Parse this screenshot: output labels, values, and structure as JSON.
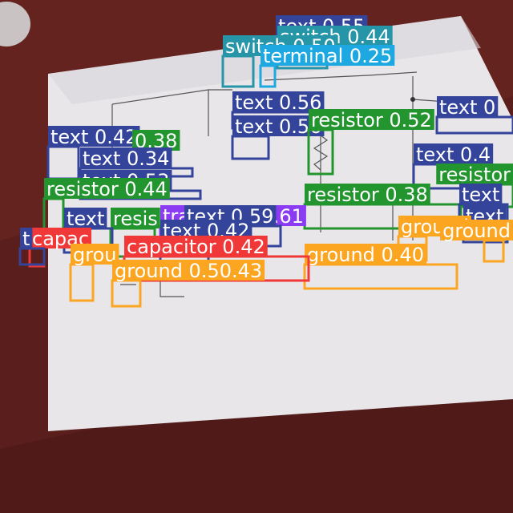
{
  "photo": {
    "subject": "hand-drawn circuit sketch on paper",
    "background_color": "#5a1f1c",
    "paper_color": "#e9e6ea"
  },
  "class_colors": {
    "text": "#33449a",
    "resistor": "#23952f",
    "switch": "#2795a8",
    "terminal": "#1ea8e2",
    "transistor": "#8b3cf2",
    "capacitor": "#ef3837",
    "ground": "#fba521"
  },
  "detections": [
    {
      "cls": "text",
      "label": "text 0.55"
    },
    {
      "cls": "switch",
      "label": "switch 0.44"
    },
    {
      "cls": "switch",
      "label": "switch 0.50"
    },
    {
      "cls": "terminal",
      "label": "terminal 0.25"
    },
    {
      "cls": "text",
      "label": "text 0.56"
    },
    {
      "cls": "text",
      "label": "text 0.56"
    },
    {
      "cls": "resistor",
      "label": "resistor 0.52"
    },
    {
      "cls": "text",
      "label": "text 0"
    },
    {
      "cls": "text",
      "label": "text 0.42"
    },
    {
      "cls": "resistor",
      "label": "0.38"
    },
    {
      "cls": "text",
      "label": "text 0.34"
    },
    {
      "cls": "text",
      "label": "text 0.53"
    },
    {
      "cls": "resistor",
      "label": "resistor 0.44"
    },
    {
      "cls": "text",
      "label": "text 0.4"
    },
    {
      "cls": "resistor",
      "label": "resistor"
    },
    {
      "cls": "resistor",
      "label": "resistor 0.38"
    },
    {
      "cls": "text",
      "label": "text"
    },
    {
      "cls": "text",
      "label": "text"
    },
    {
      "cls": "transistor",
      "label": "transistor 0.61"
    },
    {
      "cls": "text",
      "label": "text 0.59"
    },
    {
      "cls": "resistor",
      "label": "resis"
    },
    {
      "cls": "text",
      "label": "text"
    },
    {
      "cls": "text",
      "label": "text 0.42"
    },
    {
      "cls": "ground",
      "label": "ground"
    },
    {
      "cls": "ground",
      "label": "ground"
    },
    {
      "cls": "ground",
      "label": "ground 0.40"
    },
    {
      "cls": "capacitor",
      "label": "capac"
    },
    {
      "cls": "text",
      "label": "t"
    },
    {
      "cls": "capacitor",
      "label": "capacitor 0.42"
    },
    {
      "cls": "ground",
      "label": "grou"
    },
    {
      "cls": "ground",
      "label": "ground 0.50.43"
    }
  ]
}
